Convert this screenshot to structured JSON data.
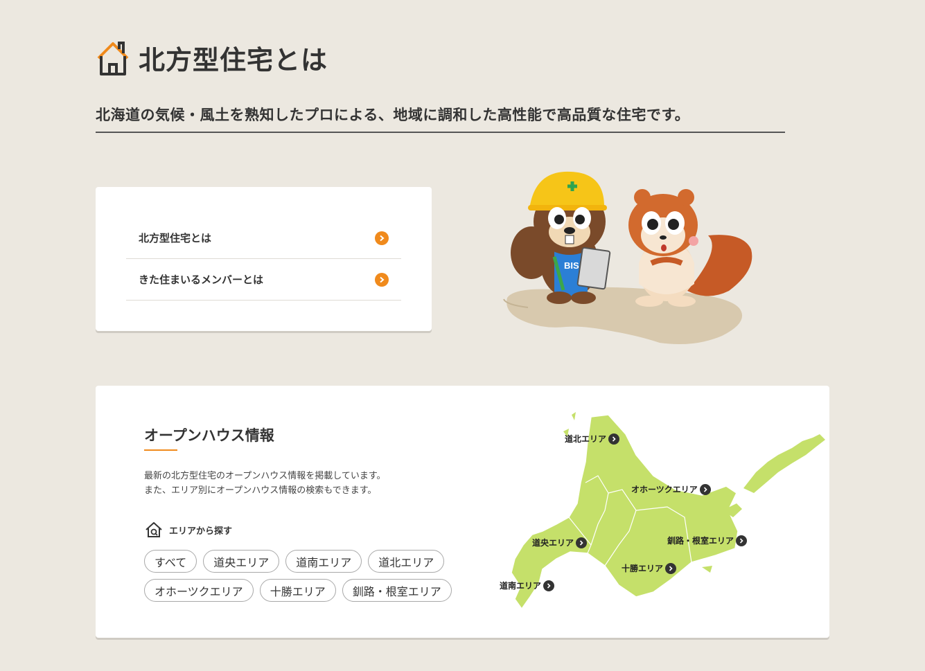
{
  "page": {
    "title": "北方型住宅とは",
    "subtitle": "北海道の気候・風土を熟知したプロによる、地域に調和した高性能で高品質な住宅です。"
  },
  "menu": {
    "items": [
      {
        "label": "北方型住宅とは"
      },
      {
        "label": "きた住まいるメンバーとは"
      }
    ]
  },
  "openhouse": {
    "title": "オープンハウス情報",
    "desc_line1": "最新の北方型住宅のオープンハウス情報を掲載しています。",
    "desc_line2": "また、エリア別にオープンハウス情報の検索もできます。",
    "area_heading": "エリアから探す",
    "tags_row1": [
      "すべて",
      "道央エリア",
      "道南エリア",
      "道北エリア"
    ],
    "tags_row2": [
      "オホーツクエリア",
      "十勝エリア",
      "釧路・根室エリア"
    ],
    "map_labels": {
      "dohoku": "道北エリア",
      "okhotsk": "オホーツクエリア",
      "doo": "道央エリア",
      "kushiro": "釧路・根室エリア",
      "tokachi": "十勝エリア",
      "donan": "道南エリア"
    }
  },
  "mascot": {
    "badge_text": "BIS"
  },
  "colors": {
    "background": "#ece8e0",
    "accent": "#f08a1c",
    "map_fill": "#c5e06a",
    "card": "#ffffff"
  }
}
